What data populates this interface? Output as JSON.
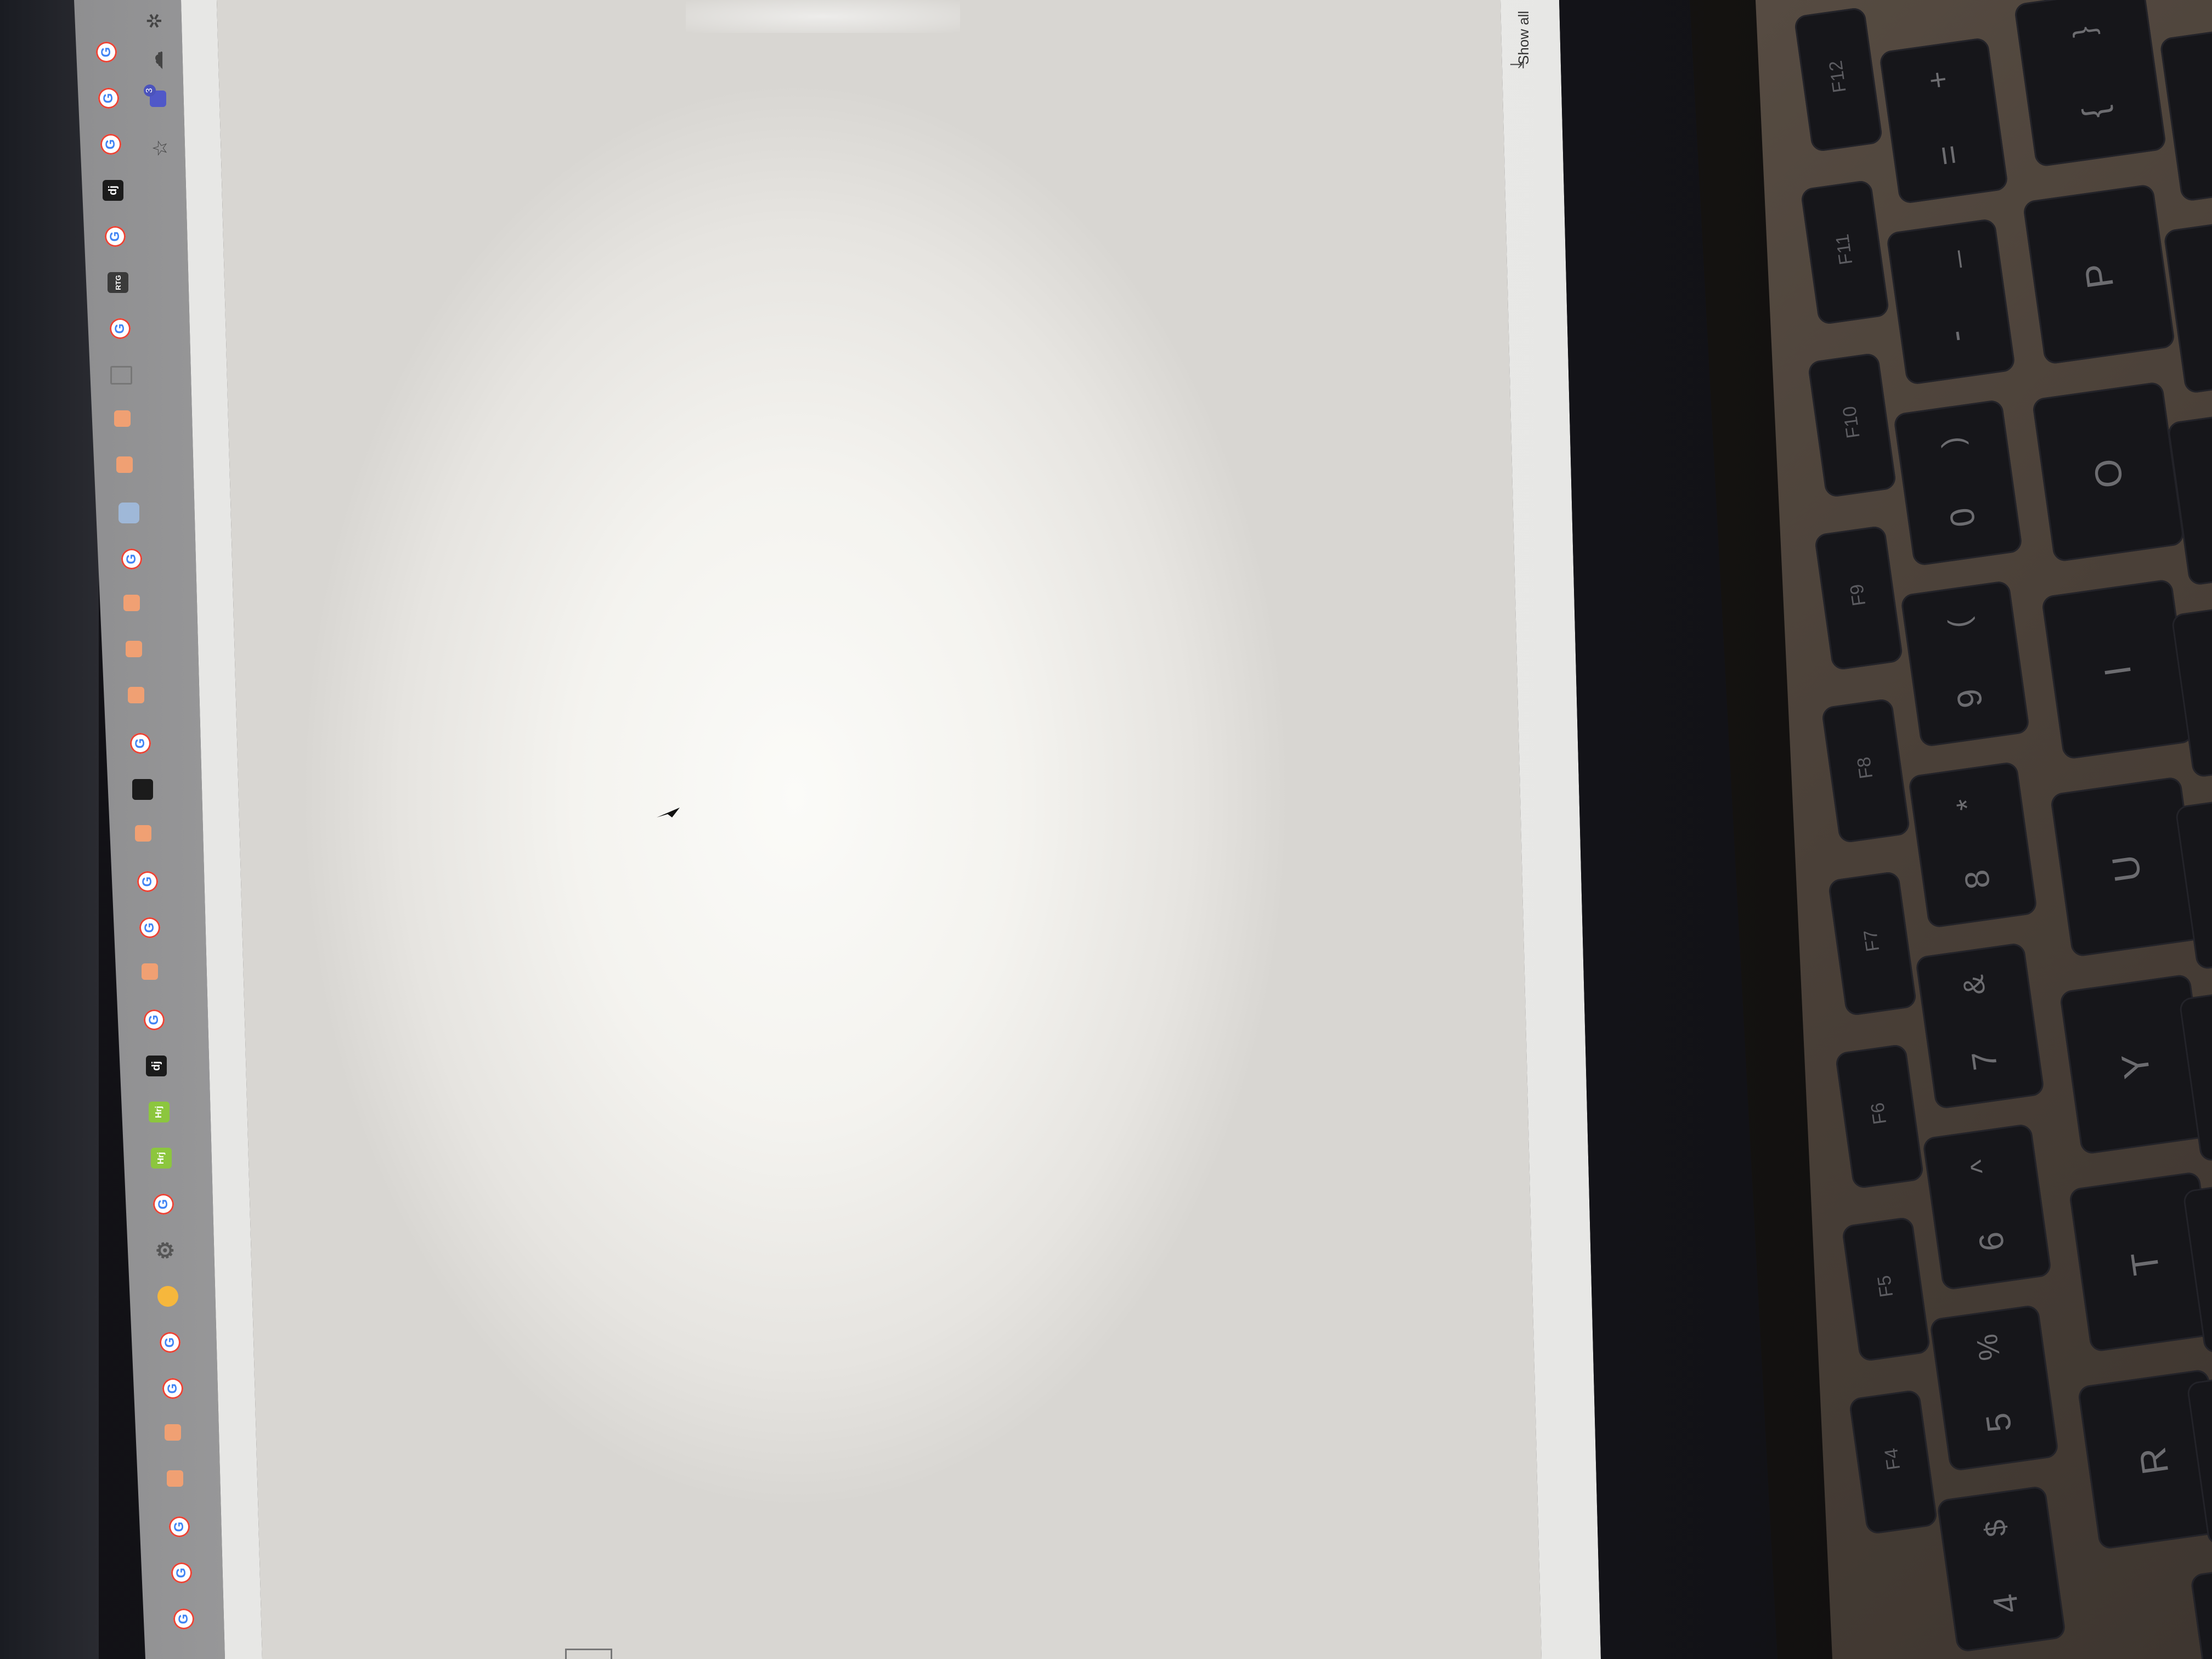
{
  "tabstrip": {
    "tab_icons": [
      {
        "icon": "google-g-icon",
        "label": "G"
      },
      {
        "icon": "google-g-icon",
        "label": "G"
      },
      {
        "icon": "google-g-icon",
        "label": "G"
      },
      {
        "icon": "dj-icon",
        "label": "dj"
      },
      {
        "icon": "google-g-icon",
        "label": "G"
      },
      {
        "icon": "rtg-icon",
        "label": "RTG"
      },
      {
        "icon": "google-g-icon",
        "label": "G"
      },
      {
        "icon": "document-icon",
        "label": ""
      },
      {
        "icon": "orange-tab-icon",
        "label": ""
      },
      {
        "icon": "orange-tab-icon",
        "label": ""
      },
      {
        "icon": "shield-icon",
        "label": ""
      },
      {
        "icon": "google-g-icon",
        "label": "G"
      },
      {
        "icon": "orange-tab-icon",
        "label": ""
      },
      {
        "icon": "orange-tab-icon",
        "label": ""
      },
      {
        "icon": "orange-tab-icon",
        "label": ""
      },
      {
        "icon": "google-g-icon",
        "label": "G"
      },
      {
        "icon": "dark-square-icon",
        "label": ""
      },
      {
        "icon": "orange-tab-icon",
        "label": ""
      },
      {
        "icon": "google-g-icon",
        "label": "G"
      },
      {
        "icon": "google-g-icon",
        "label": "G"
      },
      {
        "icon": "orange-tab-icon",
        "label": ""
      },
      {
        "icon": "google-g-icon",
        "label": "G"
      },
      {
        "icon": "dj-icon",
        "label": "dj"
      },
      {
        "icon": "green-tab-icon",
        "label": "Hrj"
      },
      {
        "icon": "green-tab-icon",
        "label": "Hrj"
      },
      {
        "icon": "google-g-icon",
        "label": "G"
      },
      {
        "icon": "gear-icon",
        "label": "⚙"
      },
      {
        "icon": "yellow-tab-icon",
        "label": ""
      },
      {
        "icon": "google-g-icon",
        "label": "G"
      },
      {
        "icon": "google-g-icon",
        "label": "G"
      },
      {
        "icon": "orange-tab-icon",
        "label": ""
      },
      {
        "icon": "orange-tab-icon",
        "label": ""
      },
      {
        "icon": "google-g-icon",
        "label": "G"
      },
      {
        "icon": "google-g-icon",
        "label": "G"
      },
      {
        "icon": "google-g-icon",
        "label": "G"
      }
    ]
  },
  "toolbar": {
    "icons": [
      "extension-icon",
      "cloud-icon",
      "teams-icon",
      "star-icon"
    ],
    "badge": "3"
  },
  "statusbar": {
    "download_label": "Show all"
  },
  "keyboard": {
    "function_row": [
      {
        "label": "F12"
      },
      {
        "label": "F11"
      },
      {
        "label": "F10"
      },
      {
        "label": "F9"
      },
      {
        "label": "F8"
      },
      {
        "label": "F7"
      },
      {
        "label": "F6"
      },
      {
        "label": "F5"
      },
      {
        "label": "F4"
      }
    ],
    "number_row": [
      {
        "top": "+",
        "bottom": "="
      },
      {
        "top": "_",
        "bottom": "-"
      },
      {
        "top": ")",
        "bottom": "0"
      },
      {
        "top": "(",
        "bottom": "9"
      },
      {
        "top": "*",
        "bottom": "8"
      },
      {
        "top": "&",
        "bottom": "7"
      },
      {
        "top": "^",
        "bottom": "6"
      },
      {
        "top": "%",
        "bottom": "5"
      },
      {
        "top": "$",
        "bottom": "4"
      }
    ],
    "letter_row": [
      {
        "top": "}",
        "bottom": "{"
      },
      {
        "top": "",
        "bottom": "P"
      },
      {
        "top": "",
        "bottom": "O"
      },
      {
        "top": "",
        "bottom": "I"
      },
      {
        "top": "",
        "bottom": "U"
      },
      {
        "top": "",
        "bottom": "Y"
      },
      {
        "top": "",
        "bottom": "T"
      },
      {
        "top": "",
        "bottom": "R"
      }
    ]
  }
}
